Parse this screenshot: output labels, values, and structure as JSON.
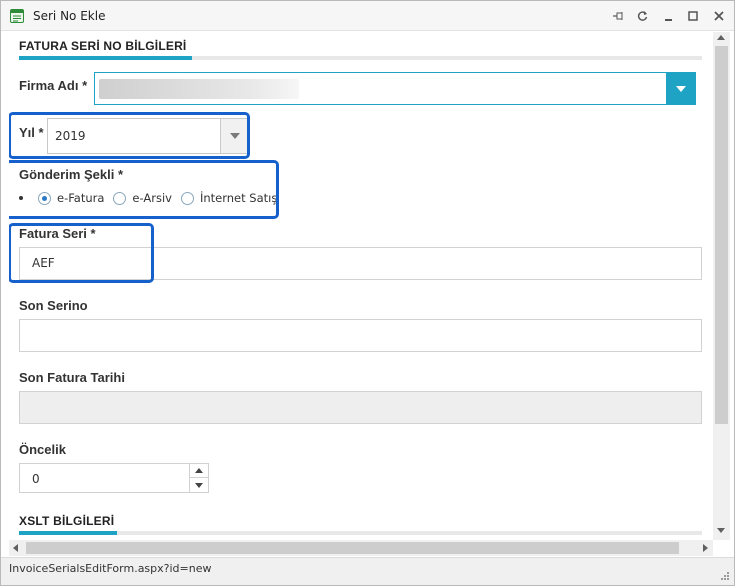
{
  "window": {
    "title": "Seri No Ekle",
    "controls": [
      "pin-icon",
      "refresh-icon",
      "minimize-icon",
      "maximize-icon",
      "close-icon"
    ]
  },
  "sections": {
    "invoice_serial": "FATURA SERİ NO BİLGİLERİ",
    "xslt": "XSLT BİLGİLERİ"
  },
  "form": {
    "firma": {
      "label": "Firma Adı *",
      "value": ""
    },
    "yil": {
      "label": "Yıl *",
      "value": "2019"
    },
    "gonderim": {
      "label": "Gönderim Şekli *",
      "options": [
        {
          "label": "e-Fatura",
          "checked": true
        },
        {
          "label": "e-Arsiv",
          "checked": false
        },
        {
          "label": "İnternet Satış",
          "checked": false
        }
      ]
    },
    "fatura_seri": {
      "label": "Fatura Seri *",
      "value": "AEF"
    },
    "son_serino": {
      "label": "Son Serino",
      "value": ""
    },
    "son_fatura_tarihi": {
      "label": "Son Fatura Tarihi",
      "value": ""
    },
    "oncelik": {
      "label": "Öncelik",
      "value": "0"
    }
  },
  "status": {
    "url": "InvoiceSerialsEditForm.aspx?id=new"
  },
  "colors": {
    "accent": "#1fa3c4",
    "highlight": "#1660cc",
    "radio_checked": "#2b78c6"
  }
}
